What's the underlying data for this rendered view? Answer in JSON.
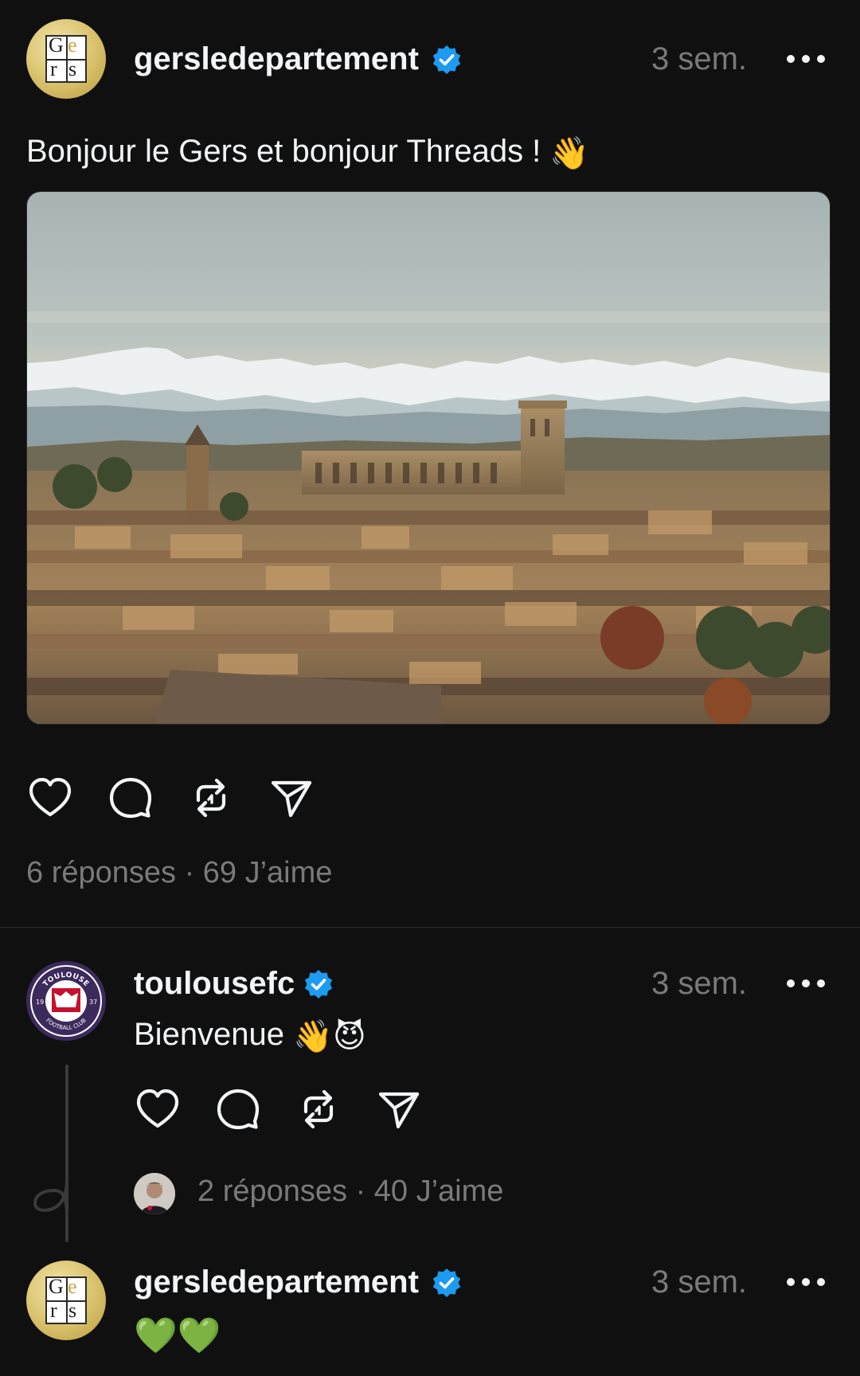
{
  "main_post": {
    "username": "gersledepartement",
    "timestamp": "3 sem.",
    "text": "Bonjour le Gers et bonjour Threads !",
    "text_emoji": "👋",
    "image_alt": "Vue d'Auch avec la cathédrale et les Pyrénées",
    "stats": "6 réponses · 69 J’aime",
    "avatar_letters": [
      "G",
      "e",
      "r",
      "s"
    ]
  },
  "reply": {
    "username": "toulousefc",
    "timestamp": "3 sem.",
    "text": "Bienvenue",
    "text_emojis": "👋😈",
    "stats": "2 réponses · 40 J’aime",
    "avatar_text_top": "TOULOUSE",
    "avatar_text_bottom": "FOOTBALL CLUB",
    "avatar_year_left": "19",
    "avatar_year_right": "37"
  },
  "nested_reply": {
    "username": "gersledepartement",
    "timestamp": "3 sem.",
    "text_emojis": "💚💚"
  },
  "colors": {
    "background": "#101010",
    "text": "#f3f5f7",
    "muted": "#7a7a7a",
    "verified": "#1d9bf0"
  },
  "icons": {
    "like": "heart-icon",
    "comment": "comment-icon",
    "repost": "repost-icon",
    "share": "send-icon",
    "more": "more-icon",
    "verified": "verified-badge-icon"
  }
}
